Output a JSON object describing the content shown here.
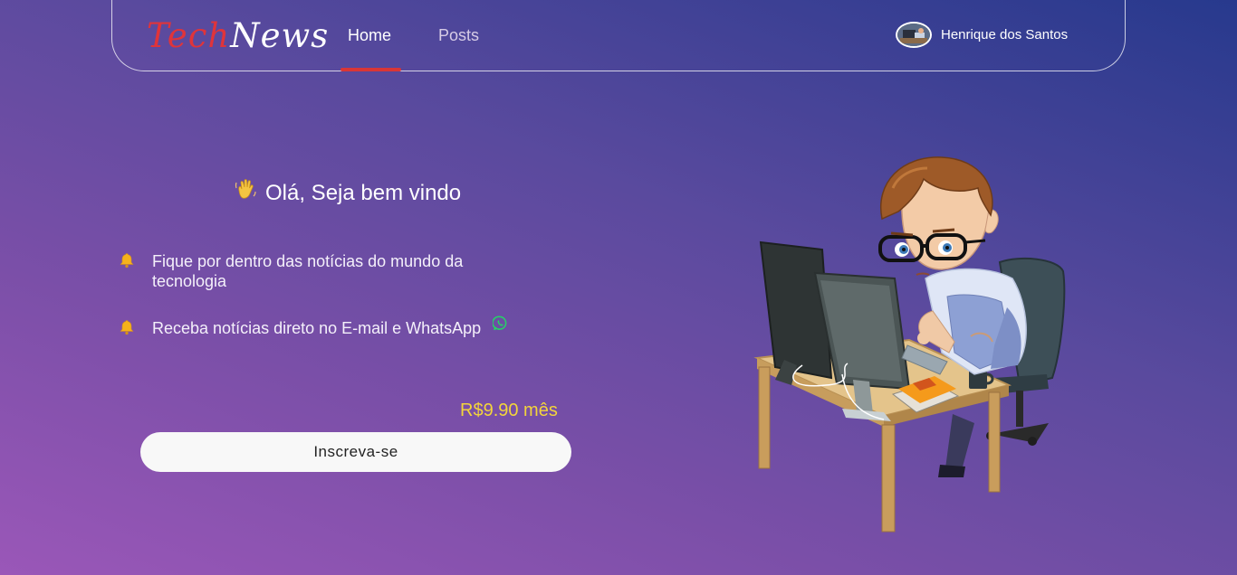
{
  "header": {
    "logo": {
      "part1": "Tech",
      "part2": "News"
    },
    "nav": [
      {
        "label": "Home",
        "active": true
      },
      {
        "label": "Posts",
        "active": false
      }
    ],
    "user": {
      "name": "Henrique dos Santos"
    }
  },
  "hero": {
    "greeting": "Olá, Seja bem vindo",
    "features": [
      {
        "icon": "bell-icon",
        "text": "Fique por dentro das notícias do mundo da tecnologia"
      },
      {
        "icon": "bell-icon",
        "text": "Receba notícias direto no E-mail e WhatsApp",
        "trailing_icon": "whatsapp-icon"
      }
    ],
    "price": "R$9.90 mês",
    "subscribe_label": "Inscreva-se"
  },
  "colors": {
    "accent_red": "#d93636",
    "price_yellow": "#f3d43b",
    "whatsapp_green": "#25d366",
    "background_start": "#9a57b8",
    "background_end": "#27398d"
  }
}
